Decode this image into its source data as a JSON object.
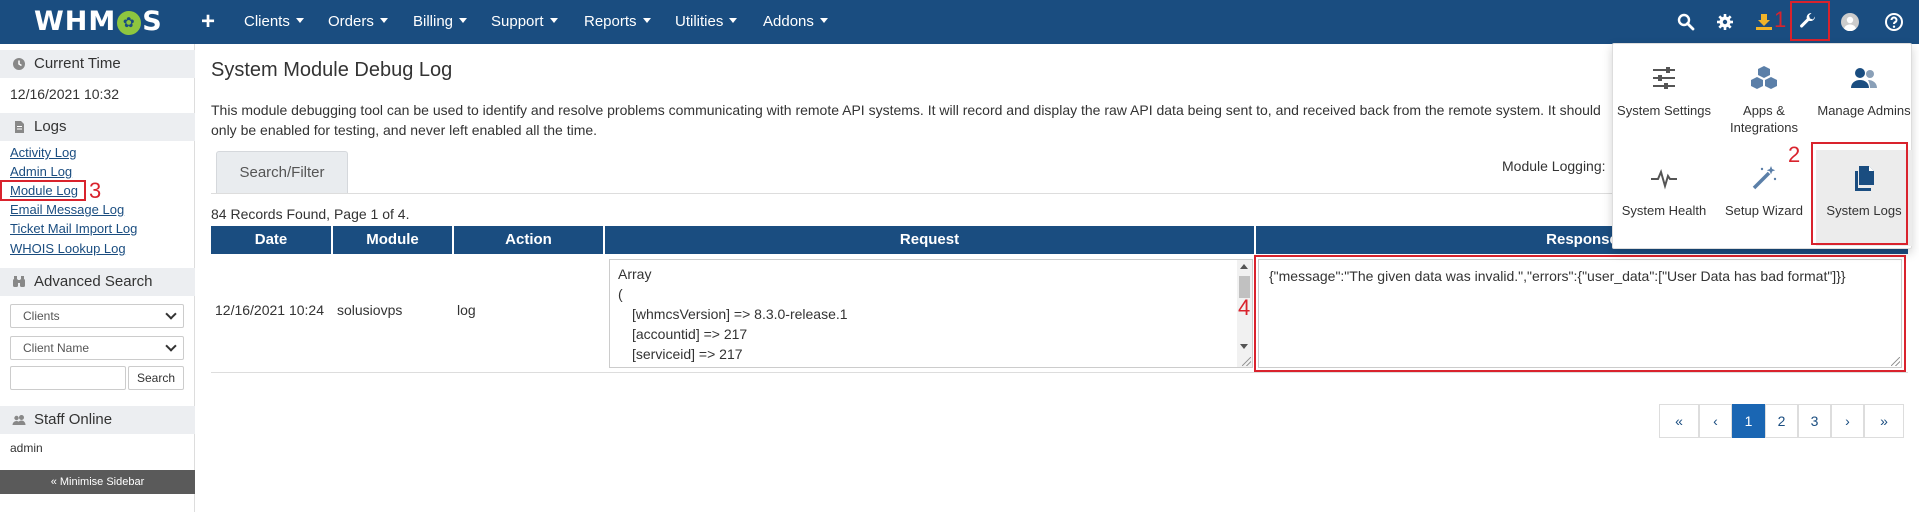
{
  "brand": {
    "logo_pre": "WHM",
    "logo_post": "S"
  },
  "nav": [
    {
      "label": "Clients"
    },
    {
      "label": "Orders"
    },
    {
      "label": "Billing"
    },
    {
      "label": "Support"
    },
    {
      "label": "Reports"
    },
    {
      "label": "Utilities"
    },
    {
      "label": "Addons"
    }
  ],
  "toolbar_icons": [
    "search-icon",
    "gear-icon",
    "download-icon",
    "wrench-icon",
    "avatar",
    "help-icon"
  ],
  "annotations": {
    "one": "1",
    "two": "2",
    "three": "3",
    "four": "4"
  },
  "sidebar": {
    "current_time_heading": "Current Time",
    "current_time": "12/16/2021 10:32",
    "logs_heading": "Logs",
    "logs": [
      {
        "label": "Activity Log"
      },
      {
        "label": "Admin Log"
      },
      {
        "label": "Module Log"
      },
      {
        "label": "Email Message Log"
      },
      {
        "label": "Ticket Mail Import Log"
      },
      {
        "label": "WHOIS Lookup Log"
      }
    ],
    "advanced_search_heading": "Advanced Search",
    "search_type": "Clients",
    "search_field": "Client Name",
    "search_button": "Search",
    "staff_online_heading": "Staff Online",
    "staff_online": "admin",
    "minimise": "« Minimise Sidebar"
  },
  "main": {
    "title": "System Module Debug Log",
    "description": "This module debugging tool can be used to identify and resolve problems communicating with remote API systems. It will record and display the raw API data being sent to, and received back from the remote system. It should only be enabled for testing, and never left enabled all the time.",
    "tab_label": "Search/Filter",
    "module_logging_label": "Module Logging:",
    "records_text": "84 Records Found, Page 1 of 4.",
    "columns": [
      "Date",
      "Module",
      "Action",
      "Request",
      "Response"
    ],
    "rows": [
      {
        "date": "12/16/2021 10:24",
        "module": "solusiovps",
        "action": "log",
        "request_lines": [
          "Array",
          "(",
          "[whmcsVersion] => 8.3.0-release.1",
          "[accountid] => 217",
          "[serviceid] => 217"
        ],
        "response": "{\"message\":\"The given data was invalid.\",\"errors\":{\"user_data\":[\"User Data has bad format\"]}}"
      }
    ]
  },
  "pagination": {
    "pages": [
      "1",
      "2",
      "3"
    ],
    "current": "1",
    "first": "«",
    "prev": "‹",
    "next": "›",
    "last": "»"
  },
  "dropdown": {
    "items": [
      {
        "label": "System Settings"
      },
      {
        "label": "Apps & Integrations"
      },
      {
        "label": "Manage Admins"
      },
      {
        "label": "System Health"
      },
      {
        "label": "Setup Wizard"
      },
      {
        "label": "System Logs"
      }
    ]
  },
  "colors": {
    "topbar": "#1a4d80",
    "accent": "#d9232d",
    "active_page": "#1a66b3",
    "logo_gear": "#8ec63f"
  }
}
